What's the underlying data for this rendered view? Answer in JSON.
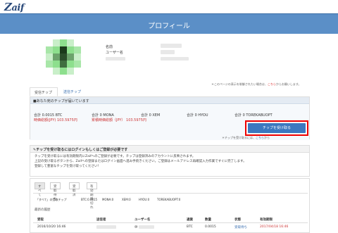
{
  "header": {
    "logo_prefix": "Z",
    "logo_text": "aif",
    "page_title": "プロフィール"
  },
  "colors": {
    "brand_blue": "#5b8fc7",
    "button_blue": "#3b78c0",
    "highlight_red": "#ee0000",
    "avatar_green": "#8ddf8d"
  },
  "profile": {
    "name_label": "名前",
    "username_label": "ユーザー名",
    "public_note": "＊このページの表示を制御されたい場合は、",
    "public_note_link": "こちら",
    "public_note_tail": "からお願いします。"
  },
  "tabs": [
    {
      "label": "受信チップ"
    },
    {
      "label": "送信チップ"
    }
  ],
  "tip_panel": {
    "header": "あなた宛のチップが届いています",
    "totals": [
      {
        "label": "合計",
        "value": "0.0015 BTC"
      },
      {
        "label": "合計",
        "value": "0 MONA"
      },
      {
        "label": "合計",
        "value": "0 XEM"
      },
      {
        "label": "合計",
        "value": "0 HYOU"
      },
      {
        "label": "合計",
        "value": "0 TOREKABUOPT"
      }
    ],
    "jpy_label": "時価総額(JPY)",
    "jpy_value": "103.5975円",
    "jpy2_label": "累積時価総額（JPY）",
    "jpy2_value": "103.5975円",
    "receive_button": "チップを受け取る",
    "button_note": "＊チップを受け取るには、",
    "button_note_link": "こちら",
    "button_note_tail": "から"
  },
  "notice_panel": {
    "header": "チップを受け取るにはログインもしくはご登録が必要です",
    "lines": [
      "チップを受け取るには有効期限内にZaifへのご登録が必要です。チップは登録済みのアカウントに反映されます。",
      "上記の受け取るボタンから、Zaifへの登録またはログイン画面へ進み手続きください。ご登録はメールアドレス再確認入力作業ですぐに完了します。",
      "登録して豊富なチップを受け取ってください！"
    ]
  },
  "history": {
    "subtabs": [
      {
        "label": "すべて"
      },
      {
        "label": "受取待ち"
      },
      {
        "label": "受取済"
      },
      {
        "label": "有効期限切れ"
      }
    ],
    "filters": [
      {
        "label": "「すべて」の受取チップ"
      },
      {
        "label": "BTC:0.0015"
      },
      {
        "label": "MONA:0"
      },
      {
        "label": "XEM:0"
      },
      {
        "label": "HYOU:0"
      },
      {
        "label": "TOREKABUOPT:0"
      }
    ],
    "recent_label": "最新の履歴",
    "columns": [
      "受取",
      "送信者",
      "ユーザー名",
      "通貨",
      "数量",
      "状態",
      "有効期限"
    ],
    "rows": [
      {
        "date": "2016/10/20 16:46",
        "sender": "",
        "username": "@",
        "currency": "BTC",
        "amount": "0.0015",
        "status": "受取待ち",
        "expires": "2017/04/18 16:46"
      }
    ]
  }
}
